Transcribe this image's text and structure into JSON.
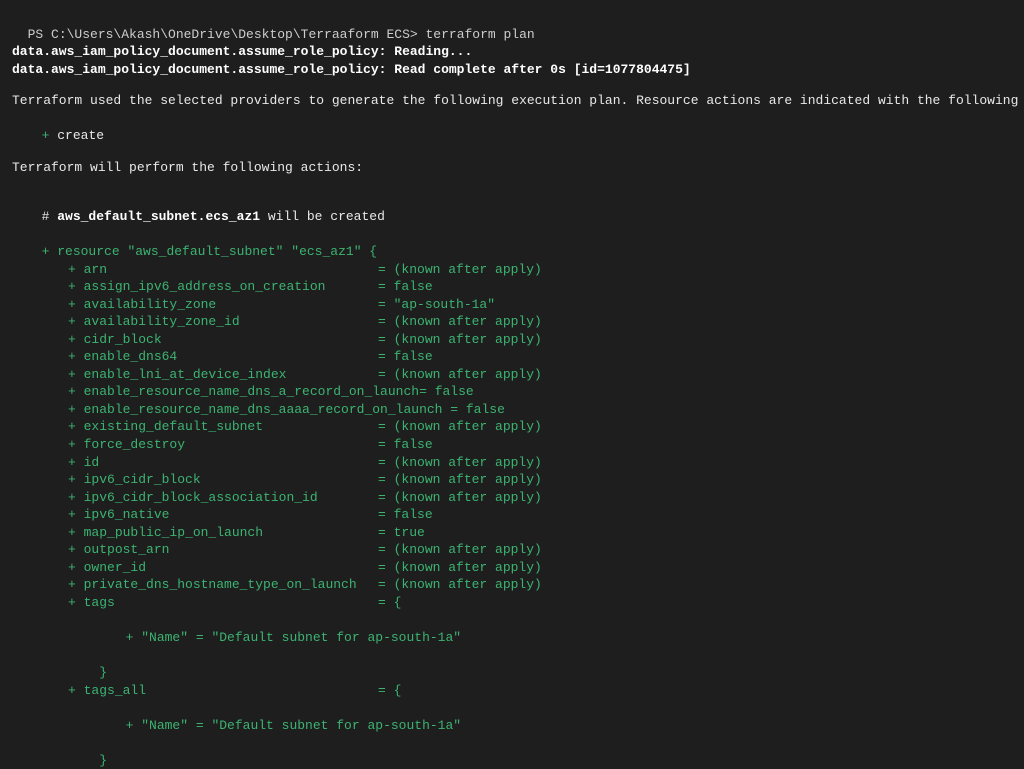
{
  "prompt": {
    "path": "PS C:\\Users\\Akash\\OneDrive\\Desktop\\Terraaform ECS> ",
    "command": "terraform plan"
  },
  "reading_lines": [
    "data.aws_iam_policy_document.assume_role_policy: Reading...",
    "data.aws_iam_policy_document.assume_role_policy: Read complete after 0s [id=1077804475]"
  ],
  "intro_line": "Terraform used the selected providers to generate the following execution plan. Resource actions are indicated with the following symbols:",
  "create_symbol": "+",
  "create_label": "create",
  "actions_line": "Terraform will perform the following actions:",
  "resource_comment": {
    "hash": "# ",
    "name": "aws_default_subnet.ecs_az1",
    "suffix": " will be created"
  },
  "resource_decl": {
    "plus": "+ ",
    "prefix": "resource ",
    "type": "\"aws_default_subnet\"",
    "space": " ",
    "name": "\"ecs_az1\"",
    "brace": " {"
  },
  "attrs": [
    {
      "key": "arn",
      "val": "(known after apply)"
    },
    {
      "key": "assign_ipv6_address_on_creation",
      "val": "false"
    },
    {
      "key": "availability_zone",
      "val": "\"ap-south-1a\"",
      "string": true
    },
    {
      "key": "availability_zone_id",
      "val": "(known after apply)"
    },
    {
      "key": "cidr_block",
      "val": "(known after apply)"
    },
    {
      "key": "enable_dns64",
      "val": "false"
    },
    {
      "key": "enable_lni_at_device_index",
      "val": "(known after apply)"
    },
    {
      "key": "enable_resource_name_dns_a_record_on_launch",
      "val": "false",
      "tight": true
    },
    {
      "key": "enable_resource_name_dns_aaaa_record_on_launch",
      "val": "false",
      "tight2": true
    },
    {
      "key": "existing_default_subnet",
      "val": "(known after apply)"
    },
    {
      "key": "force_destroy",
      "val": "false"
    },
    {
      "key": "id",
      "val": "(known after apply)"
    },
    {
      "key": "ipv6_cidr_block",
      "val": "(known after apply)"
    },
    {
      "key": "ipv6_cidr_block_association_id",
      "val": "(known after apply)"
    },
    {
      "key": "ipv6_native",
      "val": "false"
    },
    {
      "key": "map_public_ip_on_launch",
      "val": "true"
    },
    {
      "key": "outpost_arn",
      "val": "(known after apply)"
    },
    {
      "key": "owner_id",
      "val": "(known after apply)"
    },
    {
      "key": "private_dns_hostname_type_on_launch",
      "val": "(known after apply)"
    }
  ],
  "tags": {
    "key": "tags",
    "brace": "{",
    "name_key": "\"Name\"",
    "name_val": "\"Default subnet for ap-south-1a\"",
    "close": "}"
  },
  "tags_all": {
    "key": "tags_all",
    "brace": "{",
    "name_key": "\"Name\"",
    "name_val": "\"Default subnet for ap-south-1a\"",
    "close": "}"
  }
}
